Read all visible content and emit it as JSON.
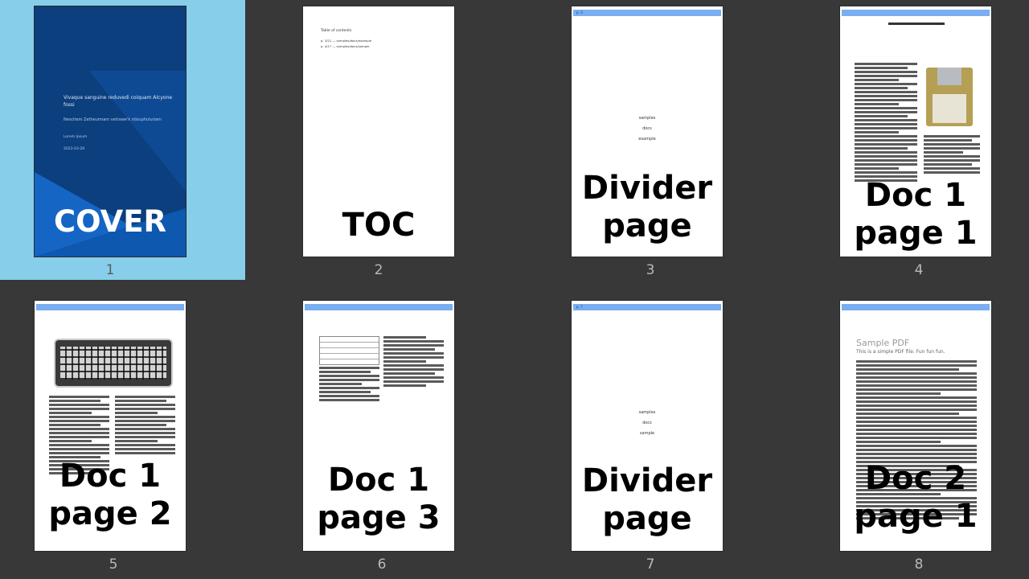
{
  "thumbnails": [
    {
      "number": "1",
      "overlay": "COVER",
      "selected": true
    },
    {
      "number": "2",
      "overlay": "TOC"
    },
    {
      "number": "3",
      "overlay_line1": "Divider",
      "overlay_line2": "page"
    },
    {
      "number": "4",
      "overlay_line1": "Doc 1",
      "overlay_line2": "page 1"
    },
    {
      "number": "5",
      "overlay_line1": "Doc 1",
      "overlay_line2": "page 2"
    },
    {
      "number": "6",
      "overlay_line1": "Doc 1",
      "overlay_line2": "page 3"
    },
    {
      "number": "7",
      "overlay_line1": "Divider",
      "overlay_line2": "page"
    },
    {
      "number": "8",
      "overlay_line1": "Doc 2",
      "overlay_line2": "page 1"
    }
  ],
  "cover_page": {
    "title": "Vivaque sanguine reduvedi coiquam Alcyone fossi",
    "subtitle": "Nescitem Zetheumiam vetrawe'k stisuphuluriam",
    "author": "Lorem Ipsum",
    "date": "2023-03-29"
  },
  "toc_page": {
    "heading": "Table of contents",
    "entries": [
      "p. 3/21 — samples/docs/example",
      "p. 4/17 — samples/docs/sample"
    ]
  },
  "divider_1": {
    "bar_text": "p. 3",
    "lines": [
      "samples",
      "docs",
      "example"
    ]
  },
  "divider_2": {
    "bar_text": "p. 7",
    "lines": [
      "samples",
      "docs",
      "sample"
    ]
  },
  "doc2": {
    "title": "Sample PDF",
    "subtitle": "This is a simple PDF file. Fun fun fun."
  }
}
